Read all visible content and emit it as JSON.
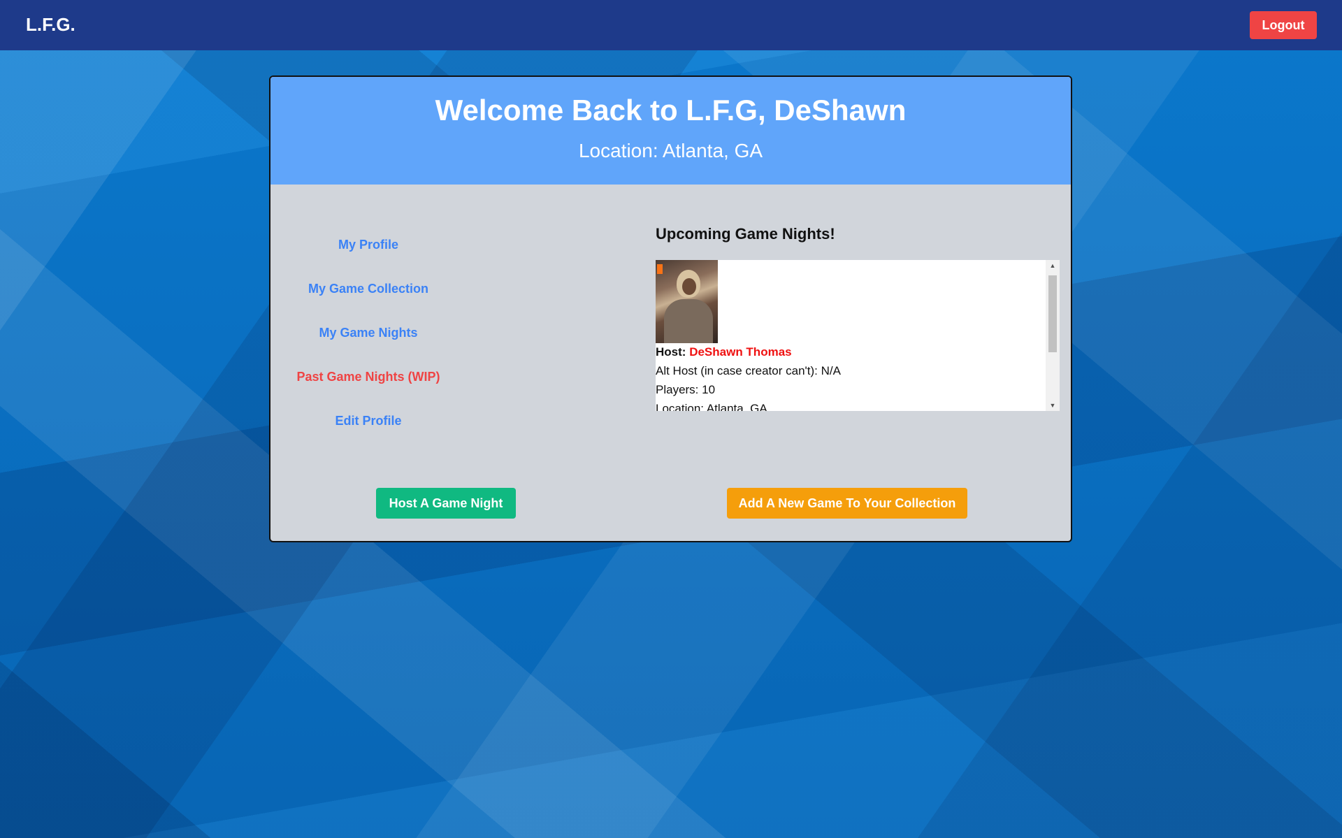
{
  "navbar": {
    "brand": "L.F.G.",
    "logout_label": "Logout"
  },
  "header": {
    "welcome": "Welcome Back to L.F.G, DeShawn",
    "location": "Location: Atlanta, GA"
  },
  "menu": {
    "items": [
      {
        "label": "My Profile"
      },
      {
        "label": "My Game Collection"
      },
      {
        "label": "My Game Nights"
      },
      {
        "label": "Past Game Nights (WIP)"
      },
      {
        "label": "Edit Profile"
      }
    ]
  },
  "upcoming": {
    "title": "Upcoming Game Nights!",
    "event": {
      "host_label": "Host:",
      "host_name": "DeShawn Thomas",
      "alt_host": "Alt Host (in case creator can't): N/A",
      "players": "Players: 10",
      "location": "Location: Atlanta, GA"
    }
  },
  "actions": {
    "host_button": "Host A Game Night",
    "add_button": "Add A New Game To Your Collection"
  },
  "colors": {
    "navbar": "#1e3a8a",
    "logout": "#ef4444",
    "header": "#60a5fa",
    "link": "#3b82f6",
    "link_wip": "#ef4444",
    "host_button": "#10b981",
    "add_button": "#f59e0b"
  }
}
